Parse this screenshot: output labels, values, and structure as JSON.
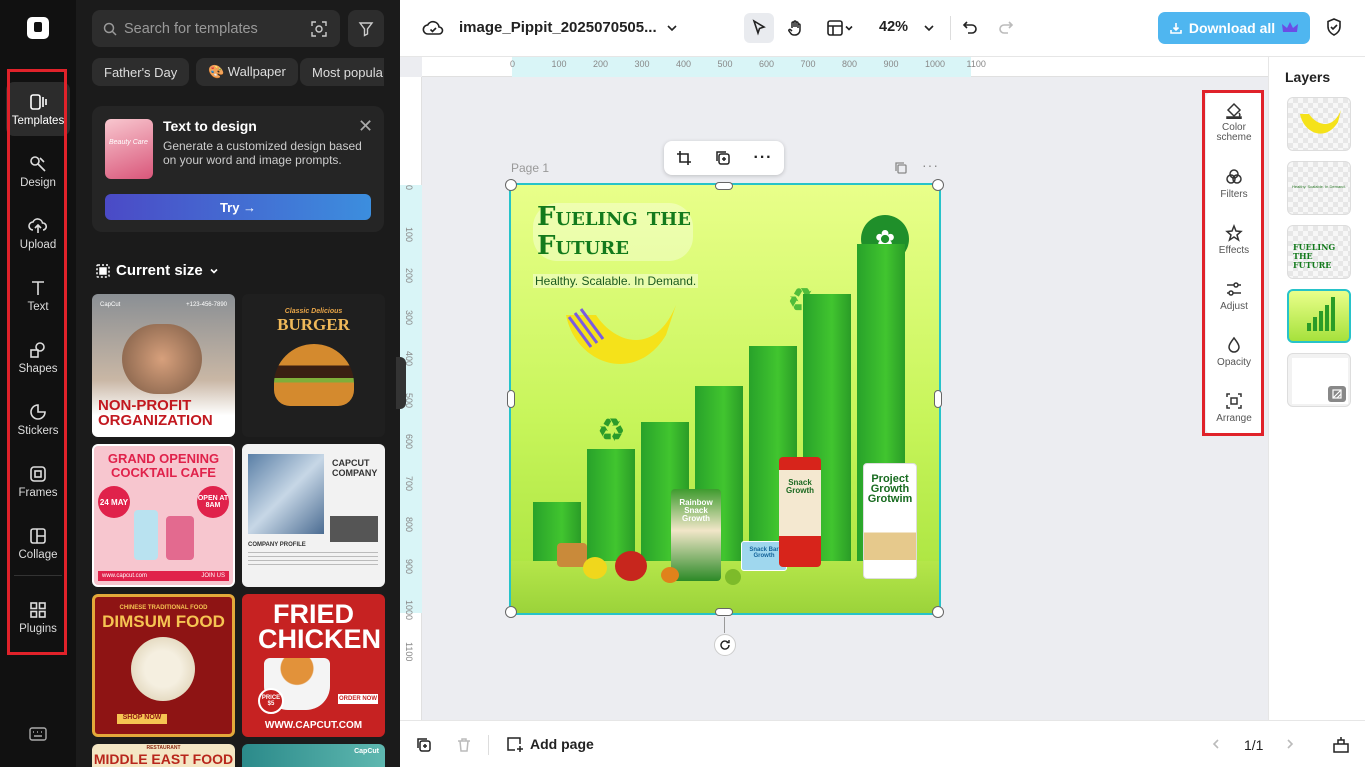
{
  "rail": {
    "items": [
      {
        "label": "Templates",
        "icon": "templates-icon",
        "active": true
      },
      {
        "label": "Design",
        "icon": "design-icon"
      },
      {
        "label": "Upload",
        "icon": "upload-icon"
      },
      {
        "label": "Text",
        "icon": "text-icon"
      },
      {
        "label": "Shapes",
        "icon": "shapes-icon"
      },
      {
        "label": "Stickers",
        "icon": "stickers-icon"
      },
      {
        "label": "Frames",
        "icon": "frames-icon"
      },
      {
        "label": "Collage",
        "icon": "collage-icon"
      },
      {
        "label": "Plugins",
        "icon": "plugins-icon"
      }
    ]
  },
  "panel": {
    "search_placeholder": "Search for templates",
    "chips": [
      "Father's Day",
      "🎨 Wallpaper",
      "Most popula"
    ],
    "text_to_design": {
      "title": "Text to design",
      "thumb_label": "Beauty Care",
      "description": "Generate a customized design based on your word and image prompts.",
      "try_label": "Try →"
    },
    "section_title": "Current size",
    "templates": [
      {
        "title": "NON-PROFIT ORGANIZATION",
        "brand": "CapCut",
        "phone": "+123-456-7890"
      },
      {
        "title": "BURGER",
        "subtitle": "Classic Delicious"
      },
      {
        "title": "GRAND OPENING COCKTAIL CAFE",
        "date": "24 MAY",
        "badge": "OPEN AT 8AM",
        "footer": "www.capcut.com",
        "cta": "JOIN US"
      },
      {
        "title": "CAPCUT COMPANY",
        "subtitle": "COMPANY PROFILE"
      },
      {
        "title": "DIMSUM FOOD",
        "subtitle": "CHINESE TRADITIONAL FOOD",
        "cta": "SHOP NOW"
      },
      {
        "title": "FRIED CHICKEN",
        "price": "PRICE $5",
        "footer": "WWW.CAPCUT.COM",
        "cta": "ORDER NOW"
      },
      {
        "title": "MIDDLE EAST FOOD",
        "subtitle": "RESTAURANT"
      },
      {
        "brand": "CapCut"
      }
    ]
  },
  "topbar": {
    "filename": "image_Pippit_2025070505...",
    "zoom": "42%",
    "download_label": "Download all"
  },
  "canvas": {
    "ruler_h": [
      "0",
      "100",
      "200",
      "300",
      "400",
      "500",
      "600",
      "700",
      "800",
      "900",
      "1000",
      "1100"
    ],
    "ruler_v": [
      "0",
      "100",
      "200",
      "300",
      "400",
      "500",
      "600",
      "700",
      "800",
      "900",
      "1000",
      "1100"
    ],
    "page_label": "Page 1",
    "design": {
      "headline_line1": "Fueling the",
      "headline_line2": "Future",
      "tagline": "Healthy. Scalable. In Demand.",
      "bar_levels": [
        0.18,
        0.34,
        0.42,
        0.53,
        0.65,
        0.81,
        0.96
      ],
      "products": [
        "Rainbow Snack Growth",
        "Snack Growth",
        "Snack Bar Growth",
        "Project Growth Grotwim"
      ]
    }
  },
  "right_tools": [
    {
      "label": "Color scheme",
      "icon": "paint-bucket-icon"
    },
    {
      "label": "Filters",
      "icon": "filters-icon"
    },
    {
      "label": "Effects",
      "icon": "effects-icon"
    },
    {
      "label": "Adjust",
      "icon": "adjust-icon"
    },
    {
      "label": "Opacity",
      "icon": "opacity-icon"
    },
    {
      "label": "Arrange",
      "icon": "arrange-icon"
    }
  ],
  "layers": {
    "title": "Layers",
    "layer2_text": "Healthy. Scalable. In Demand.",
    "layer3_text": "FUELING THE FUTURE"
  },
  "bottombar": {
    "add_page_label": "Add page",
    "page_indicator": "1/1"
  },
  "colors": {
    "accent": "#4fb6f0",
    "selection": "#27c3c9",
    "highlight_box": "#e0222a"
  }
}
